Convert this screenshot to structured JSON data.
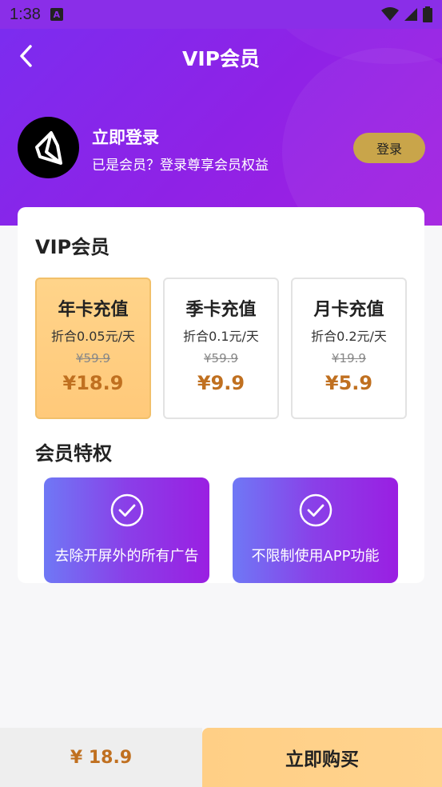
{
  "status": {
    "time": "1:38",
    "notif_letter": "A"
  },
  "nav": {
    "title": "VIP会员"
  },
  "profile": {
    "title": "立即登录",
    "subtitle": "已是会员？登录尊享会员权益",
    "login_label": "登录"
  },
  "vip": {
    "title": "VIP会员",
    "plans": [
      {
        "name": "年卡充值",
        "per": "折合0.05元/天",
        "old": "¥59.9",
        "price": "¥18.9",
        "selected": true
      },
      {
        "name": "季卡充值",
        "per": "折合0.1元/天",
        "old": "¥59.9",
        "price": "¥9.9",
        "selected": false
      },
      {
        "name": "月卡充值",
        "per": "折合0.2元/天",
        "old": "¥19.9",
        "price": "¥5.9",
        "selected": false
      }
    ]
  },
  "privileges": {
    "title": "会员特权",
    "items": [
      {
        "label": "去除开屏外的所有广告",
        "icon": "check-circle-icon"
      },
      {
        "label": "不限制使用APP功能",
        "icon": "check-circle-icon"
      }
    ]
  },
  "footer": {
    "price": "¥ 18.9",
    "buy_label": "立即购买"
  },
  "colors": {
    "brand_purple": "#8a2ee8",
    "gold": "#c9a54a",
    "price": "#c07020",
    "selected_card": "#ffd48a"
  }
}
